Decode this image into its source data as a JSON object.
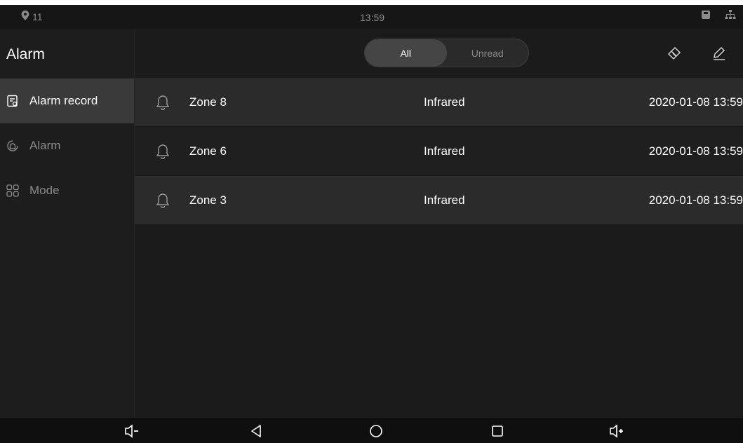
{
  "status_bar": {
    "signal": "11",
    "time": "13:59"
  },
  "sidebar": {
    "title": "Alarm",
    "items": [
      {
        "label": "Alarm record",
        "icon": "record-icon",
        "active": true
      },
      {
        "label": "Alarm",
        "icon": "alarm-icon",
        "active": false
      },
      {
        "label": "Mode",
        "icon": "mode-grid-icon",
        "active": false
      }
    ]
  },
  "header": {
    "tabs": [
      {
        "label": "All",
        "active": true
      },
      {
        "label": "Unread",
        "active": false
      }
    ],
    "actions": [
      "clear-icon",
      "edit-icon"
    ]
  },
  "records": [
    {
      "zone": "Zone 8",
      "type": "Infrared",
      "time": "2020-01-08 13:59"
    },
    {
      "zone": "Zone 6",
      "type": "Infrared",
      "time": "2020-01-08 13:59"
    },
    {
      "zone": "Zone 3",
      "type": "Infrared",
      "time": "2020-01-08 13:59"
    }
  ],
  "bottom_nav": [
    "volume-down-icon",
    "back-icon",
    "home-icon",
    "recents-icon",
    "volume-up-icon"
  ],
  "colors": {
    "background": "#1b1b1b",
    "active_item": "#3a3a3a",
    "text": "#ffffff",
    "muted": "#8a8a8a"
  }
}
